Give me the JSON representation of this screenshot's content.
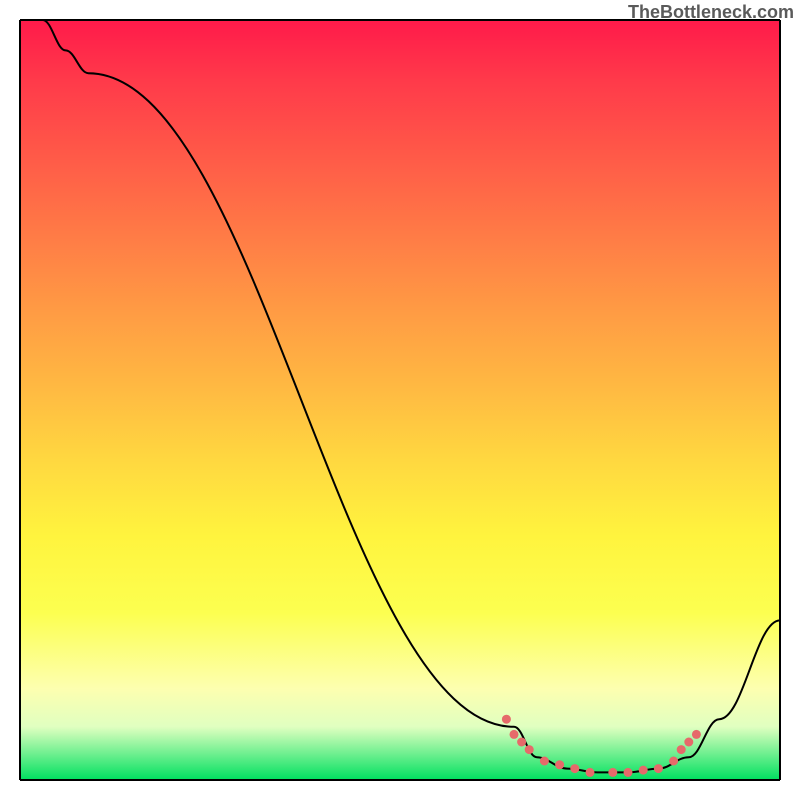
{
  "watermark": "TheBottleneck.com",
  "chart_data": {
    "type": "line",
    "title": "",
    "xlabel": "",
    "ylabel": "",
    "xlim": [
      0,
      100
    ],
    "ylim": [
      0,
      100
    ],
    "grid": false,
    "legend": false,
    "background_gradient": {
      "direction": "vertical",
      "stops": [
        {
          "pos": 0.0,
          "color": "#ff1a4a"
        },
        {
          "pos": 0.5,
          "color": "#ffd840"
        },
        {
          "pos": 0.9,
          "color": "#fcff80"
        },
        {
          "pos": 1.0,
          "color": "#00e060"
        }
      ]
    },
    "series": [
      {
        "name": "bottleneck-curve",
        "type": "line",
        "color": "#000000",
        "points": [
          {
            "x": 3,
            "y": 100
          },
          {
            "x": 6,
            "y": 96
          },
          {
            "x": 9,
            "y": 93
          },
          {
            "x": 65,
            "y": 7
          },
          {
            "x": 68,
            "y": 3
          },
          {
            "x": 72,
            "y": 1.5
          },
          {
            "x": 76,
            "y": 1
          },
          {
            "x": 80,
            "y": 1
          },
          {
            "x": 84,
            "y": 1.5
          },
          {
            "x": 88,
            "y": 3
          },
          {
            "x": 92,
            "y": 8
          },
          {
            "x": 100,
            "y": 21
          }
        ]
      },
      {
        "name": "markers",
        "type": "scatter",
        "color": "#e66a6a",
        "points": [
          {
            "x": 64,
            "y": 8
          },
          {
            "x": 65,
            "y": 6
          },
          {
            "x": 66,
            "y": 5
          },
          {
            "x": 67,
            "y": 4
          },
          {
            "x": 69,
            "y": 2.5
          },
          {
            "x": 71,
            "y": 2
          },
          {
            "x": 73,
            "y": 1.5
          },
          {
            "x": 75,
            "y": 1
          },
          {
            "x": 78,
            "y": 1
          },
          {
            "x": 80,
            "y": 1
          },
          {
            "x": 82,
            "y": 1.3
          },
          {
            "x": 84,
            "y": 1.5
          },
          {
            "x": 86,
            "y": 2.5
          },
          {
            "x": 87,
            "y": 4
          },
          {
            "x": 88,
            "y": 5
          },
          {
            "x": 89,
            "y": 6
          }
        ]
      }
    ]
  }
}
